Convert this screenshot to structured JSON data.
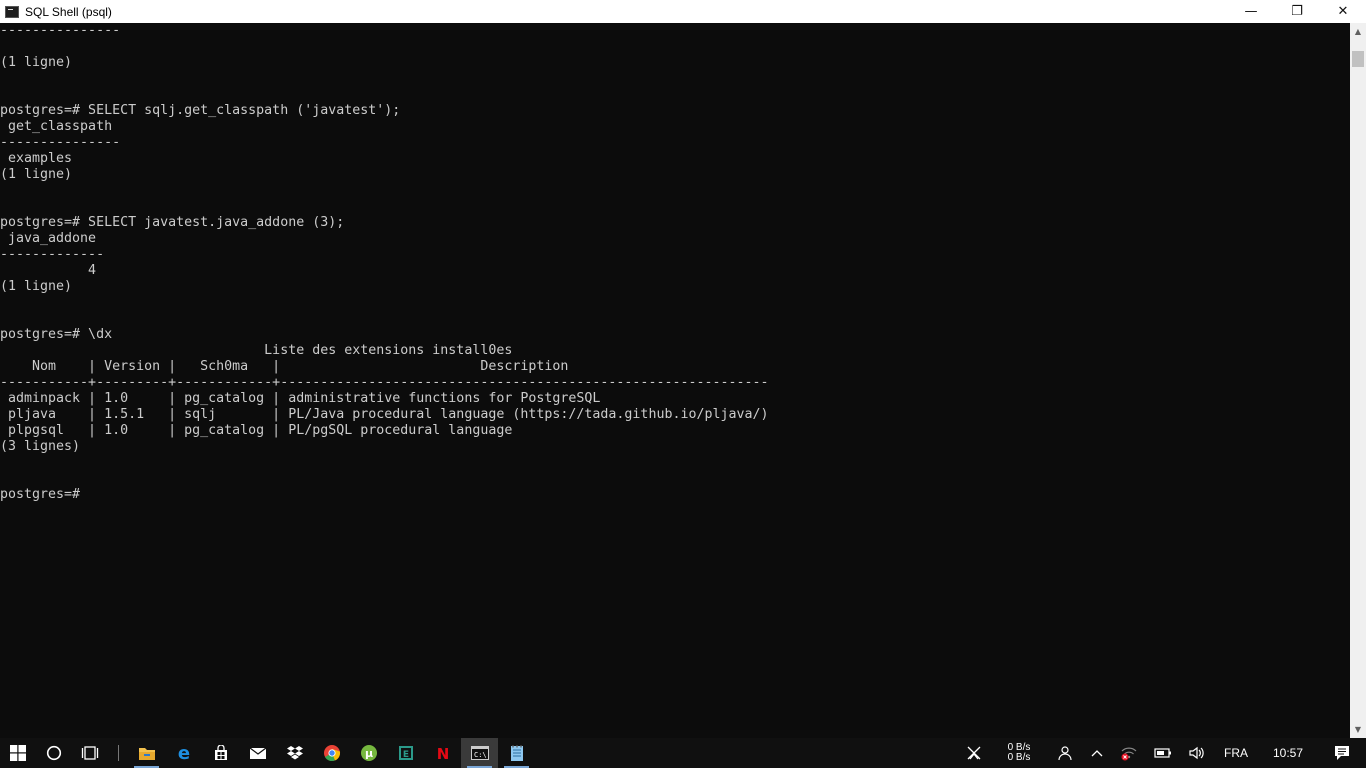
{
  "window": {
    "title": "SQL Shell (psql)",
    "controls": {
      "minimize": "—",
      "maximize": "❐",
      "close": "✕"
    }
  },
  "console": {
    "lines": [
      "---------------",
      "",
      "(1 ligne)",
      "",
      "",
      "postgres=# SELECT sqlj.get_classpath ('javatest');",
      " get_classpath",
      "---------------",
      " examples",
      "(1 ligne)",
      "",
      "",
      "postgres=# SELECT javatest.java_addone (3);",
      " java_addone",
      "-------------",
      "           4",
      "(1 ligne)",
      "",
      "",
      "postgres=# \\dx",
      "                                 Liste des extensions install0es",
      "    Nom    | Version |   Sch0ma   |                         Description",
      "-----------+---------+------------+-------------------------------------------------------------",
      " adminpack | 1.0     | pg_catalog | administrative functions for PostgreSQL",
      " pljava    | 1.5.1   | sqlj       | PL/Java procedural language (https://tada.github.io/pljava/)",
      " plpgsql   | 1.0     | pg_catalog | PL/pgSQL procedural language",
      "(3 lignes)",
      "",
      "",
      "postgres=#"
    ]
  },
  "scrollbar": {
    "up_icon": "▲",
    "down_icon": "▼"
  },
  "taskbar": {
    "apps": [
      {
        "name": "file-explorer-icon",
        "color": "#f2c14e"
      },
      {
        "name": "edge-icon",
        "color": "#1e8fe1"
      },
      {
        "name": "store-icon",
        "color": "#ffffff"
      },
      {
        "name": "mail-icon",
        "color": "#ffffff"
      },
      {
        "name": "dropbox-icon",
        "color": "#ffffff"
      },
      {
        "name": "chrome-icon",
        "color": "#e94235"
      },
      {
        "name": "utorrent-icon",
        "color": "#76b83f"
      },
      {
        "name": "app-e-icon",
        "color": "#2b9a8a"
      },
      {
        "name": "netflix-icon",
        "color": "#e50914"
      },
      {
        "name": "cmd-icon",
        "color": "#cccccc"
      },
      {
        "name": "notepad-icon",
        "color": "#8ec8f0"
      }
    ],
    "tray": {
      "net_up": "0 B/s",
      "net_down": "0 B/s",
      "language": "FRA",
      "time": "10:57"
    }
  }
}
